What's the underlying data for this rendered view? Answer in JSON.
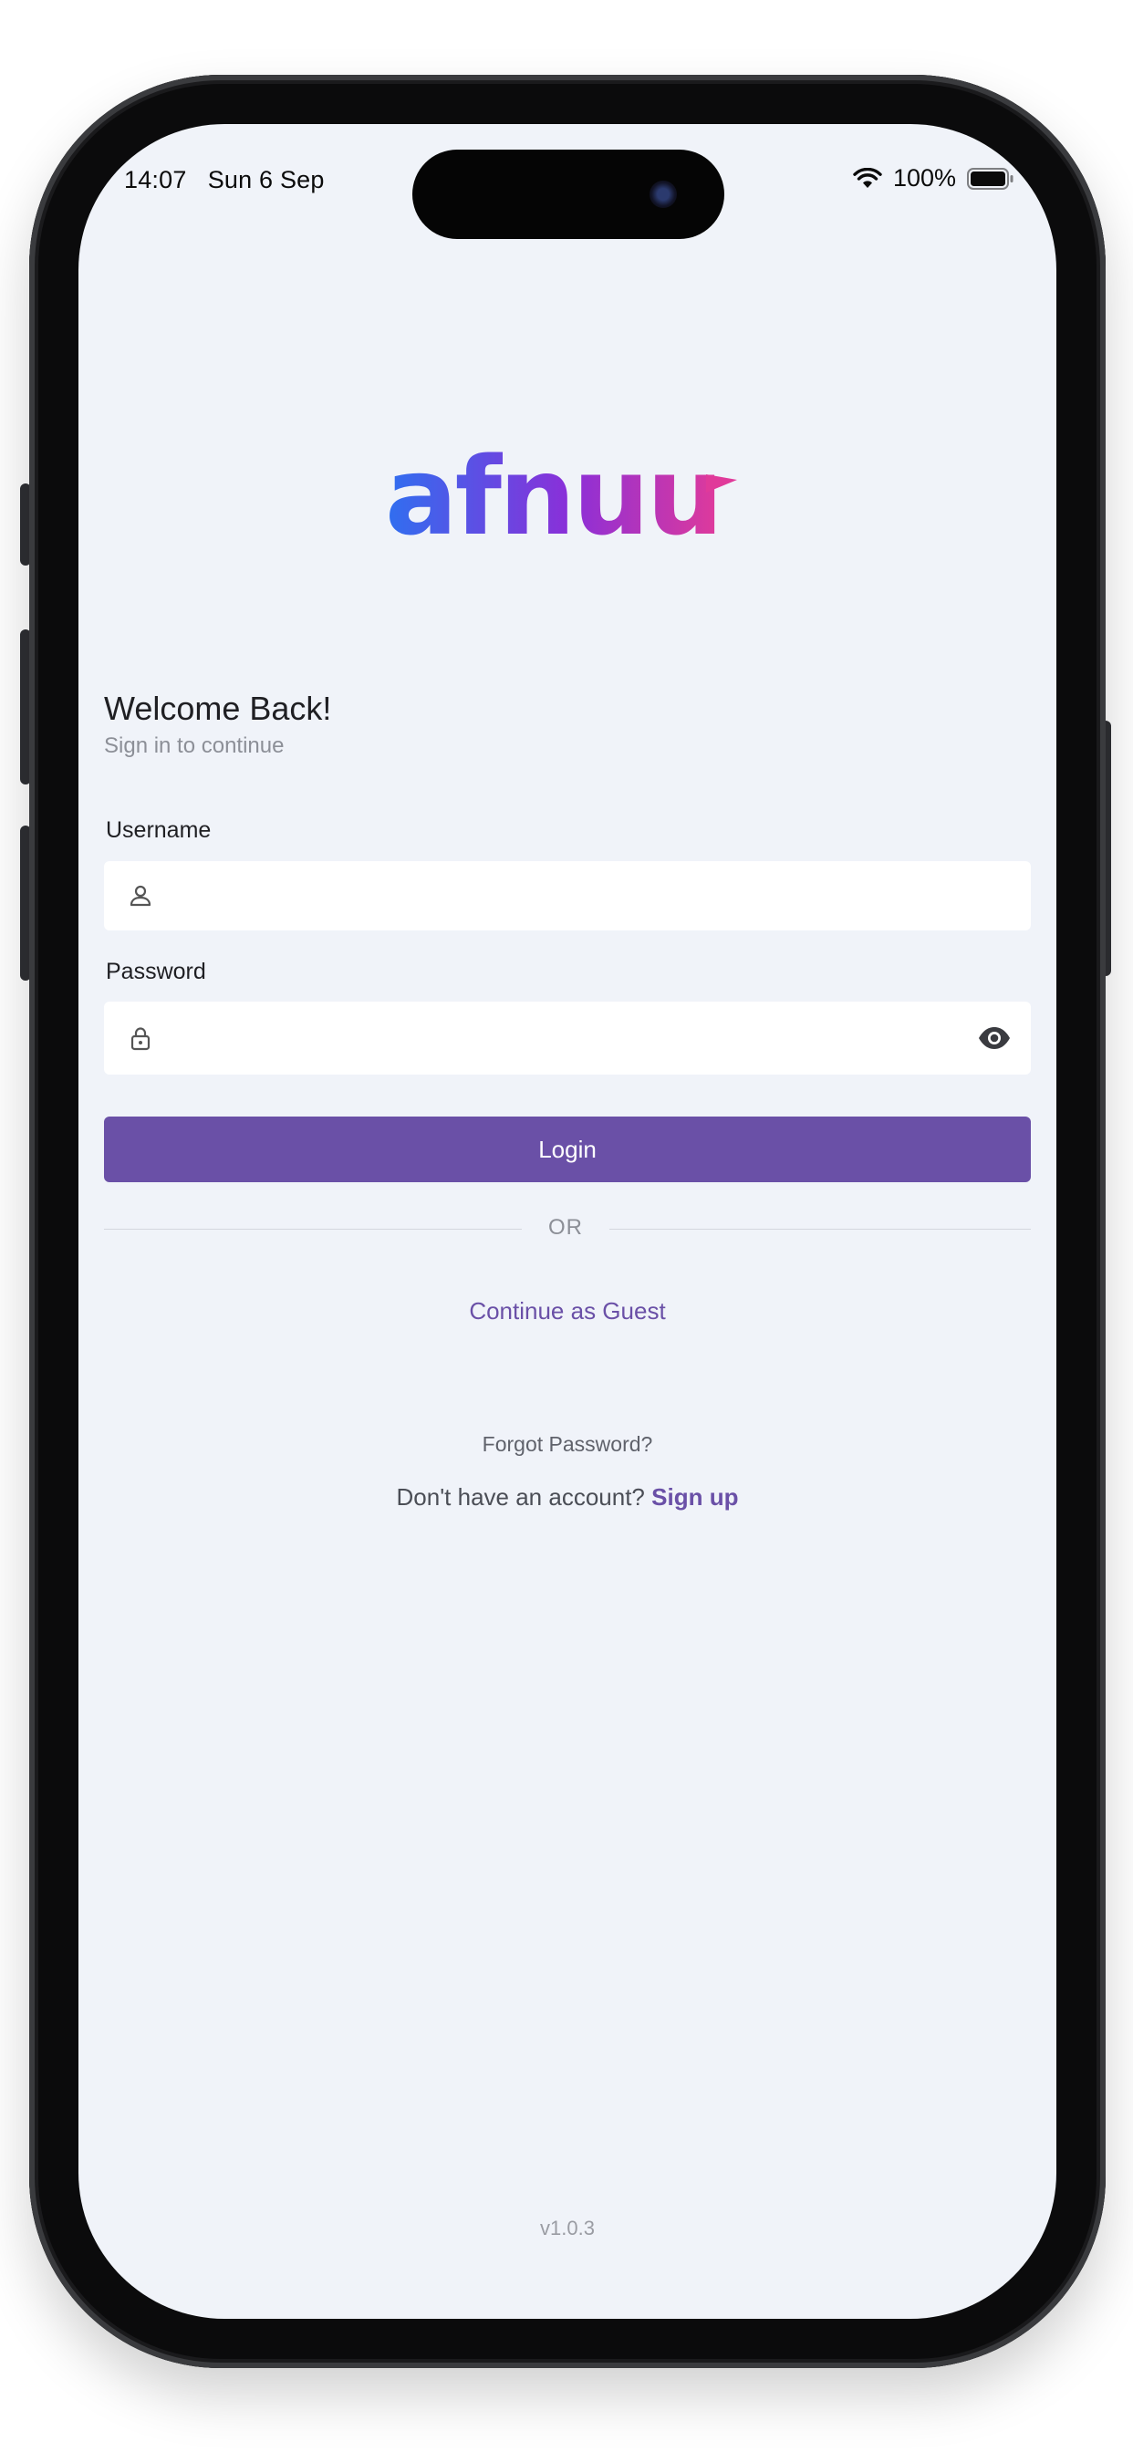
{
  "status_bar": {
    "time": "14:07",
    "date": "Sun 6 Sep",
    "battery_percent": "100%"
  },
  "brand": {
    "logo_text": "afnuu",
    "gradient_start": "#2f6ff0",
    "gradient_end": "#e03a9a"
  },
  "welcome": {
    "title": "Welcome Back!",
    "subtitle": "Sign in to continue"
  },
  "form": {
    "username_label": "Username",
    "username_value": "",
    "password_label": "Password",
    "password_value": "",
    "login_label": "Login"
  },
  "divider_text": "OR",
  "guest_label": "Continue as Guest",
  "forgot_label": "Forgot Password?",
  "signup": {
    "prompt": "Don't have an account?",
    "link": "Sign up"
  },
  "version": "v1.0.3",
  "colors": {
    "accent": "#6a50a7",
    "background": "#f0f3f9"
  },
  "icons": {
    "username_field": "person-icon",
    "password_field": "lock-icon",
    "password_toggle": "eye-icon",
    "wifi": "wifi-icon",
    "battery": "battery-icon"
  }
}
